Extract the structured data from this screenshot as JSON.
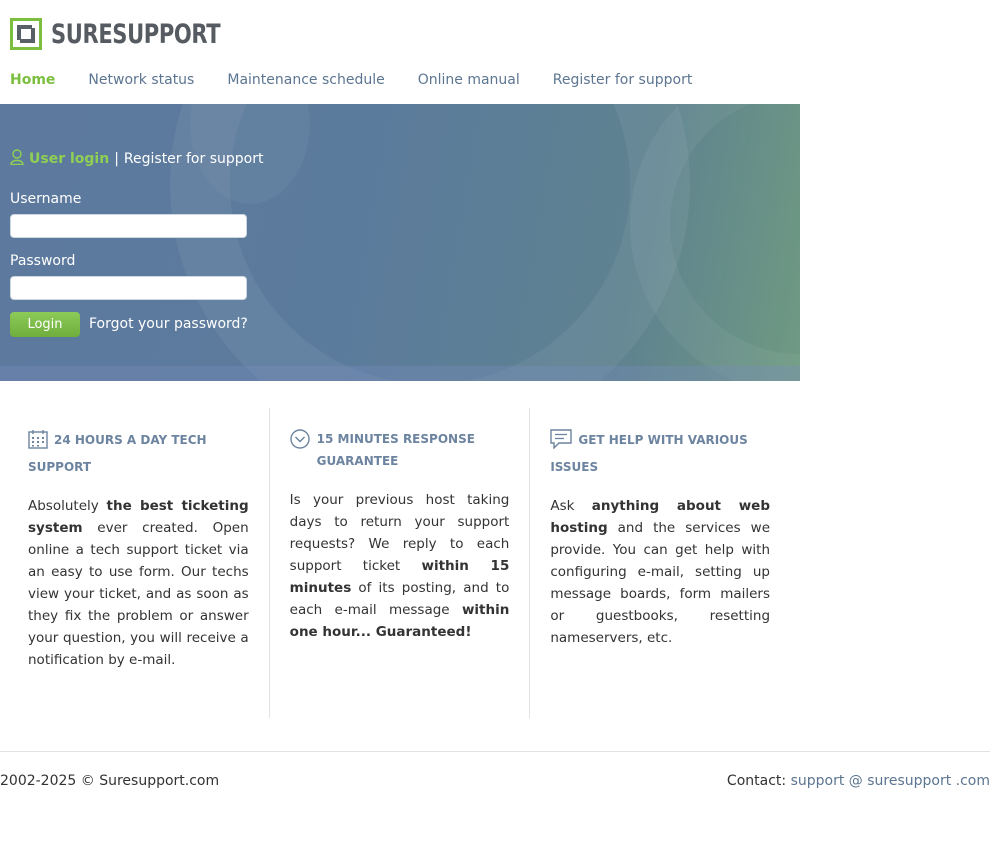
{
  "brand": {
    "name": "SURESUPPORT",
    "logo_icon": "square-logo-icon",
    "accent": "#7cbf3f",
    "dark": "#555b60"
  },
  "nav": {
    "items": [
      {
        "label": "Home",
        "active": true
      },
      {
        "label": "Network status"
      },
      {
        "label": "Maintenance schedule"
      },
      {
        "label": "Online manual"
      },
      {
        "label": "Register for support"
      }
    ]
  },
  "login": {
    "heading_active": "User login",
    "separator": "|",
    "heading_link": "Register for support",
    "username_label": "Username",
    "username_value": "",
    "password_label": "Password",
    "password_value": "",
    "button": "Login",
    "forgot": "Forgot your password?"
  },
  "features": [
    {
      "icon": "calendar-icon",
      "title": "24 HOURS A DAY TECH SUPPORT",
      "text": [
        {
          "t": "Absolutely "
        },
        {
          "t": "the best ticketing system",
          "b": true
        },
        {
          "t": " ever created. Open online a tech support ticket via an easy to use form. Our techs view your ticket, and as soon as they fix the problem or answer your question, you will receive a notification by e-mail."
        }
      ]
    },
    {
      "icon": "chevron-circle-icon",
      "title": "15 MINUTES RESPONSE GUARANTEE",
      "text": [
        {
          "t": "Is your previous host taking days to return your support requests? We reply to each support ticket "
        },
        {
          "t": "within 15 minutes",
          "b": true
        },
        {
          "t": " of its posting, and to each e-mail message "
        },
        {
          "t": "within one hour... Guaranteed!",
          "b": true
        }
      ]
    },
    {
      "icon": "chat-icon",
      "title": "GET HELP WITH VARIOUS ISSUES",
      "text": [
        {
          "t": "Ask "
        },
        {
          "t": "anything about web hosting",
          "b": true
        },
        {
          "t": " and the services we provide. You can get help with configuring e-mail, setting up message boards, form mailers or guestbooks, resetting nameservers, etc."
        }
      ]
    }
  ],
  "footer": {
    "copyright": "2002-2025 © Suresupport.com",
    "contact_label": "Contact:",
    "contact_link": "support @ suresupport .com"
  }
}
